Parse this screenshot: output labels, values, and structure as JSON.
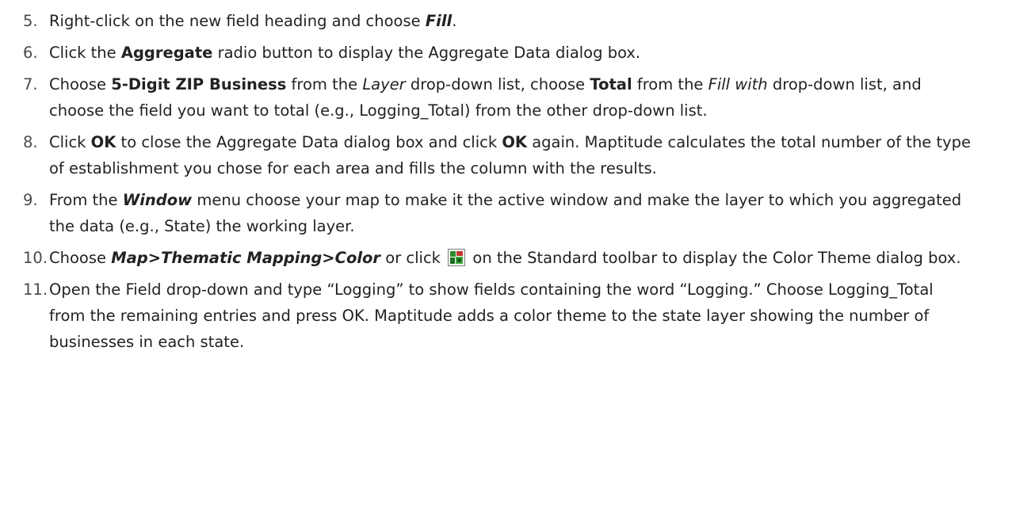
{
  "steps": [
    {
      "num": "5.",
      "parts": [
        "Right-click on the new field heading and choose ",
        "Fill",
        "."
      ]
    },
    {
      "num": "6.",
      "parts": [
        "Click the ",
        "Aggregate",
        " radio button to display the Aggregate Data dialog box."
      ]
    },
    {
      "num": "7.",
      "parts": [
        "Choose ",
        "5-Digit ZIP Business",
        " from the ",
        "Layer",
        " drop-down list, choose ",
        "Total",
        " from the ",
        "Fill with",
        " drop-down list, and choose the field you want to total (e.g., Logging_Total) from the other drop-down list."
      ]
    },
    {
      "num": "8.",
      "parts": [
        "Click ",
        "OK",
        " to close the Aggregate Data dialog box and click ",
        "OK",
        " again. Maptitude calculates the total number of the type of establishment you chose for each area and fills the column with the results."
      ]
    },
    {
      "num": "9.",
      "parts": [
        "From the ",
        "Window",
        " menu choose your map to make it the active window and make the layer to which you aggregated the data (e.g., State) the working layer."
      ]
    },
    {
      "num": "10.",
      "parts": [
        "Choose ",
        "Map>Thematic Mapping>Color",
        " or click ",
        " on the Standard toolbar to display the Color Theme dialog box."
      ],
      "icon": "color-theme-toolbar-icon"
    },
    {
      "num": "11.",
      "parts": [
        "Open the Field drop-down and type “Logging” to show fields containing the word “Logging.” Choose Logging_Total from the remaining entries and press OK. Maptitude adds a color theme to the state layer showing the number of businesses in each state."
      ]
    }
  ]
}
